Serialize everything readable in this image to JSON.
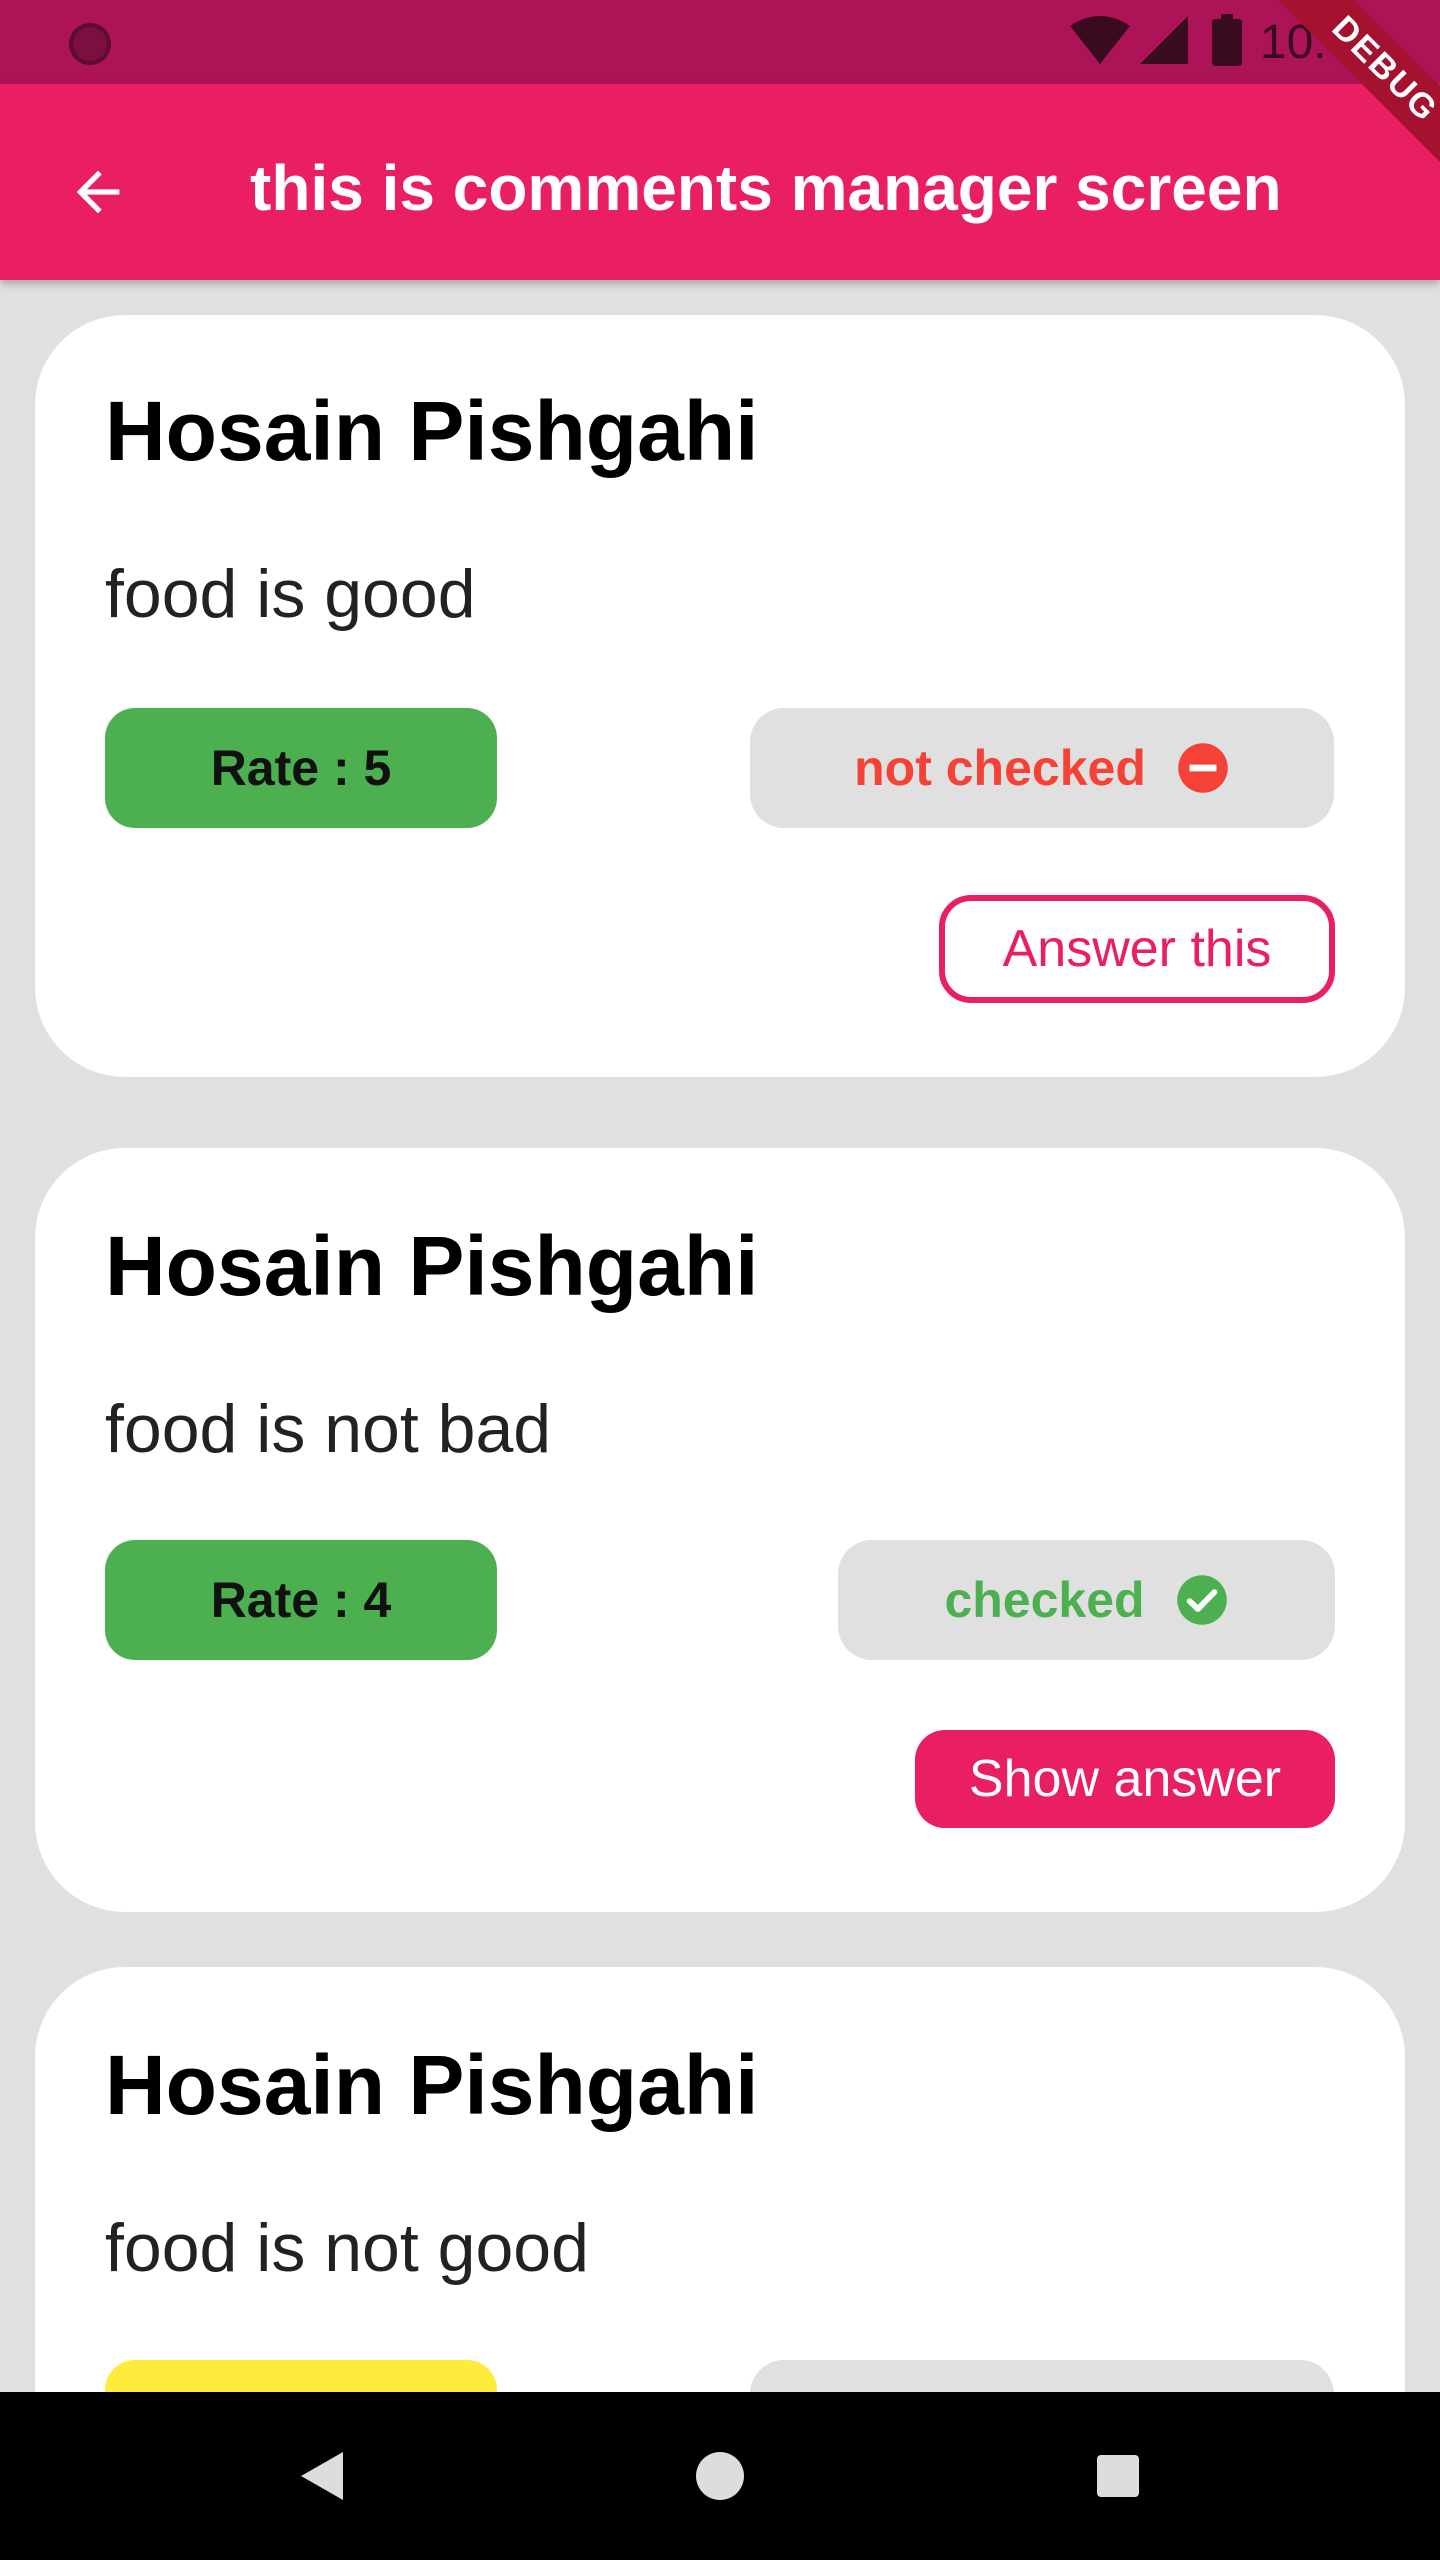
{
  "status_bar": {
    "time": "10:46",
    "icons": [
      "wifi-icon",
      "cellular-signal-icon",
      "battery-icon"
    ]
  },
  "debug_banner": "DEBUG",
  "app_bar": {
    "back_icon": "arrow-back-icon",
    "title": "this is comments manager screen"
  },
  "colors": {
    "primary": "#e91e63",
    "status_bar": "#ad1457",
    "background": "#e0e0e0",
    "rate_green": "#4caf50",
    "rate_yellow": "#ffeb3b",
    "checked_green": "#4caf50",
    "not_checked_red": "#f44336"
  },
  "comments": [
    {
      "name": "Hosain Pishgahi",
      "text": "food is good",
      "rate_label": "Rate : 5",
      "rate_color": "#4caf50",
      "status_label": "not checked",
      "status_icon": "remove-circle-icon",
      "status_color": "#f44336",
      "action_label": "Answer this",
      "action_style": "outlined"
    },
    {
      "name": "Hosain Pishgahi",
      "text": "food is not bad",
      "rate_label": "Rate : 4",
      "rate_color": "#4caf50",
      "status_label": "checked",
      "status_icon": "check-circle-icon",
      "status_color": "#4caf50",
      "action_label": "Show answer",
      "action_style": "filled"
    },
    {
      "name": "Hosain Pishgahi",
      "text": "food is not good",
      "rate_color": "#ffeb3b"
    }
  ],
  "nav_bar": {
    "back": "nav-back-icon",
    "home": "nav-home-icon",
    "recents": "nav-recents-icon"
  }
}
